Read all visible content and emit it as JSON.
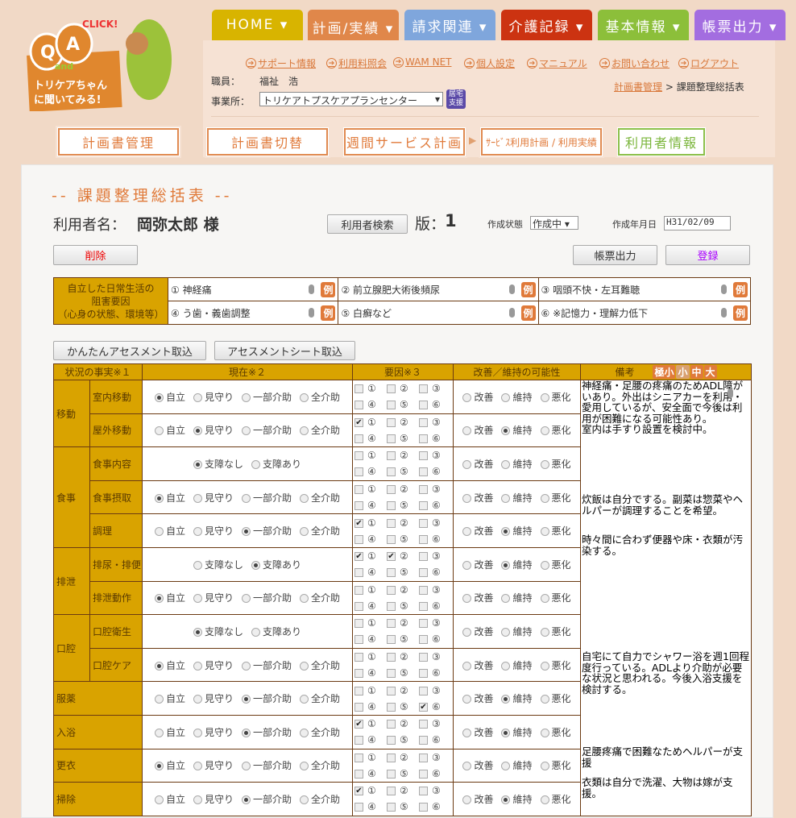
{
  "logo": {
    "text": "QA and トリケアちゃんに聞いてみる! CLICK!"
  },
  "nav": [
    {
      "label": "HOME ▾",
      "color": "#d8b400"
    },
    {
      "label": "計画/実績 ▾",
      "color": "#e0874a",
      "active": true
    },
    {
      "label": "請求関連 ▾",
      "color": "#7fa6dc"
    },
    {
      "label": "介護記録 ▾",
      "color": "#cc3311"
    },
    {
      "label": "基本情報 ▾",
      "color": "#8cbf3a"
    },
    {
      "label": "帳票出力 ▾",
      "color": "#a36de0"
    }
  ],
  "links": [
    "サポート情報",
    "利用料照会",
    "WAM NET",
    "個人設定",
    "マニュアル",
    "お問い合わせ",
    "ログアウト"
  ],
  "staff": {
    "label": "職員：",
    "name": "福祉　浩"
  },
  "office": {
    "label": "事業所：",
    "value": "トリケアトプスケアプランセンター",
    "badge": "居宅支援"
  },
  "breadcrumb": {
    "parent": "計画書管理",
    "sep": ">",
    "current": "課題整理総括表"
  },
  "subnav": [
    "計画書管理",
    "計画書切替",
    "週間サービス計画",
    "ｻｰﾋﾞｽ利用計画 / 利用実績",
    "利用者情報"
  ],
  "page": {
    "title": "-- 課題整理総括表 --",
    "user_label": "利用者名：",
    "user_name": "岡弥太郎 様",
    "search_btn": "利用者検索",
    "version_label": "版：",
    "version": "1",
    "status_label": "作成状態",
    "status": "作成中 ▾",
    "date_label": "作成年月日",
    "date": "H31/02/09",
    "delete_btn": "削除",
    "print_btn": "帳票出力",
    "save_btn": "登録"
  },
  "factors": {
    "header": [
      "自立した日常生活の",
      "阻害要因",
      "（心身の状態、環境等）"
    ],
    "rei": "例",
    "items": [
      "① 神経痛",
      "② 前立腺肥大術後頻尿",
      "③ 咽頭不快・左耳難聴",
      "④ う歯・義歯調整",
      "⑤ 白癬など",
      "⑥ ※記憶力・理解力低下"
    ]
  },
  "import_btns": [
    "かんたんアセスメント取込",
    "アセスメントシート取込"
  ],
  "grid": {
    "headers": [
      "状況の事実※１",
      "現在※２",
      "要因※３",
      "改善／維持の可能性",
      "備考"
    ],
    "sizes": [
      {
        "label": "極小",
        "color": "#e07a3a"
      },
      {
        "label": "小",
        "color": "#d9a070"
      },
      {
        "label": "中",
        "color": "#e07a3a"
      },
      {
        "label": "大",
        "color": "#e07a3a"
      }
    ],
    "adl_options": [
      "自立",
      "見守り",
      "一部介助",
      "全介助"
    ],
    "two_options": [
      "支障なし",
      "支障あり"
    ],
    "improve_options": [
      "改善",
      "維持",
      "悪化"
    ],
    "factor_nums": [
      "①",
      "②",
      "③",
      "④",
      "⑤",
      "⑥"
    ],
    "rows": [
      {
        "group": "移動",
        "span": 2,
        "item": "室内移動",
        "type": "adl",
        "sel": 0,
        "checks": [],
        "imp": null
      },
      {
        "item": "屋外移動",
        "type": "adl",
        "sel": 1,
        "checks": [
          1
        ],
        "imp": 1
      },
      {
        "group": "食事",
        "span": 3,
        "item": "食事内容",
        "type": "two",
        "sel": 0,
        "checks": [],
        "imp": null
      },
      {
        "item": "食事摂取",
        "type": "adl",
        "sel": 0,
        "checks": [],
        "imp": null
      },
      {
        "item": "調理",
        "type": "adl",
        "sel": 2,
        "checks": [
          1
        ],
        "imp": 1
      },
      {
        "group": "排泄",
        "span": 2,
        "item": "排尿・排便",
        "type": "two",
        "sel": 1,
        "checks": [
          1,
          2
        ],
        "imp": 1
      },
      {
        "item": "排泄動作",
        "type": "adl",
        "sel": 0,
        "checks": [],
        "imp": null
      },
      {
        "group": "口腔",
        "span": 2,
        "item": "口腔衛生",
        "type": "two",
        "sel": 0,
        "checks": [],
        "imp": null
      },
      {
        "item": "口腔ケア",
        "type": "adl",
        "sel": 0,
        "checks": [],
        "imp": null
      },
      {
        "single": "服薬",
        "type": "adl",
        "sel": 2,
        "checks": [
          6
        ],
        "imp": 1
      },
      {
        "single": "入浴",
        "type": "adl",
        "sel": 2,
        "checks": [
          1
        ],
        "imp": 1
      },
      {
        "single": "更衣",
        "type": "adl",
        "sel": 0,
        "checks": [],
        "imp": null
      },
      {
        "single": "掃除",
        "type": "adl",
        "sel": 2,
        "checks": [
          1
        ],
        "imp": 1
      }
    ],
    "remarks": [
      "神経痛・足腰の疼痛のためADL障がいあり。外出はシニアカーを利用・愛用しているが、安全面で今後は利用が困難になる可能性あり。\n室内は手すり設置を検討中。",
      "炊飯は自分でする。副菜は惣菜やヘルパーが調理することを希望。",
      "時々間に合わず便器や床・衣類が汚染する。",
      "自宅にて自力でシャワー浴を週1回程度行っている。ADLより介助が必要な状況と思われる。今後入浴支援を検討する。",
      "足腰疼痛で困難なためヘルパーが支援",
      "衣類は自分で洗濯、大物は嫁が支援。"
    ]
  }
}
